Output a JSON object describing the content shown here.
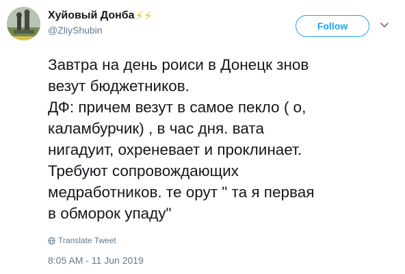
{
  "author": {
    "display_name": "Хуйовый Донба",
    "handle": "@ZliyShubin",
    "badge_glyphs": [
      "⚡",
      "⚡"
    ]
  },
  "follow_button": {
    "label": "Follow"
  },
  "tweet": {
    "lines": [
      "Завтра на день роиси в Донецк знов",
      "везут бюджетников.",
      "ДФ: причем везут в самое пекло ( о,",
      "каламбурчик) , в час дня. вата",
      "нигадуит, охреневает и проклинает.",
      "Требуют сопровождающих",
      "медработников. те орут \" та я первая",
      "в обморок упаду\""
    ]
  },
  "translate": {
    "label": "Translate Tweet",
    "icon": "globe-icon"
  },
  "timestamp": "8:05 AM - 11 Jun 2019",
  "colors": {
    "accent": "#1da1f2",
    "text": "#14171a",
    "secondary": "#657786",
    "bolt": "#f5b800"
  }
}
